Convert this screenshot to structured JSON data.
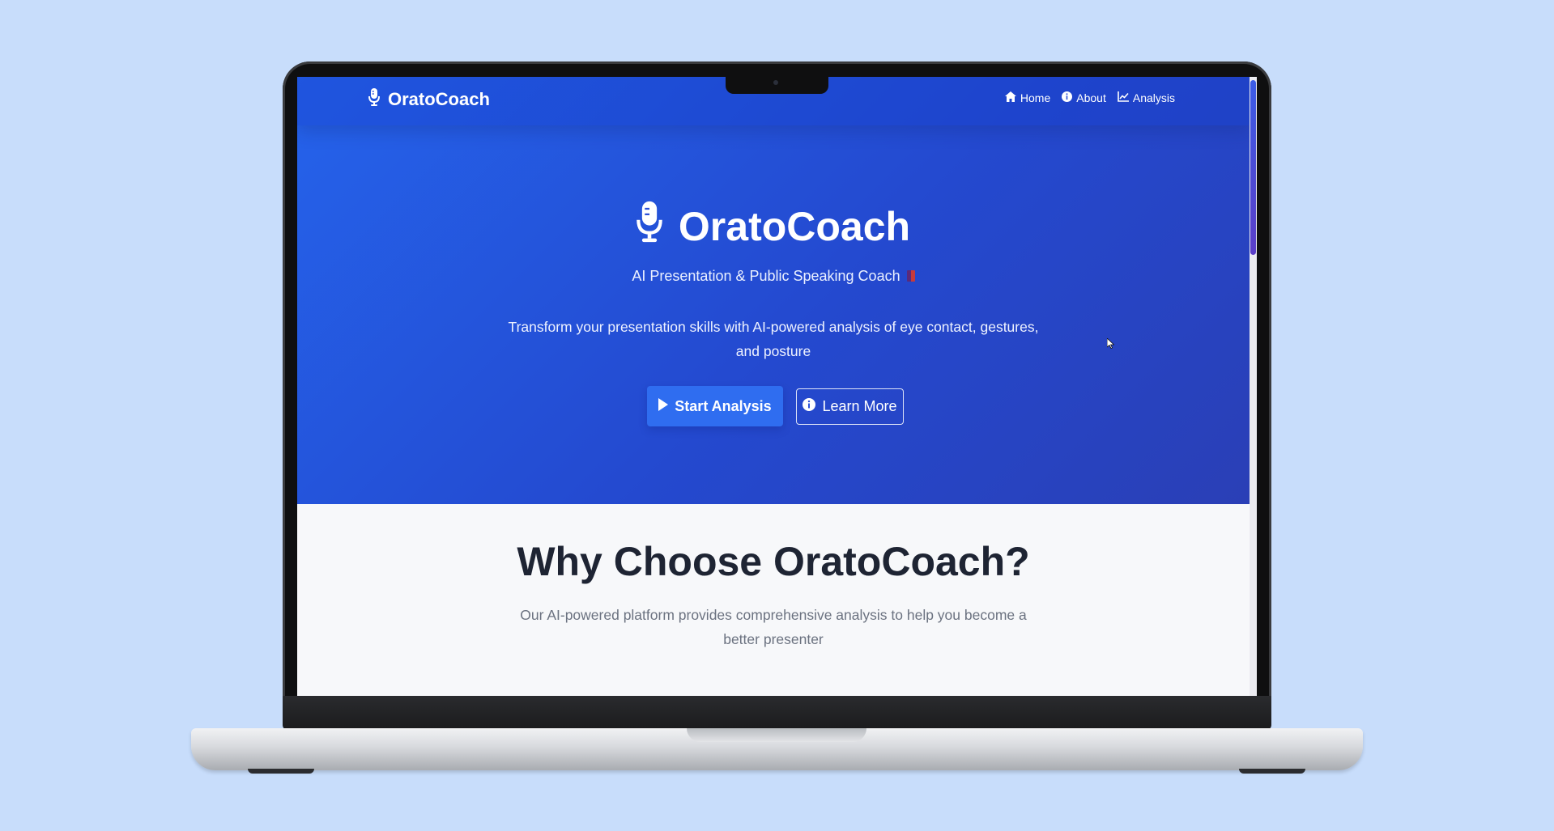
{
  "navbar": {
    "brand": "OratoCoach",
    "links": [
      {
        "label": "Home",
        "icon": "home-icon"
      },
      {
        "label": "About",
        "icon": "info-icon"
      },
      {
        "label": "Analysis",
        "icon": "chart-line-icon"
      }
    ]
  },
  "hero": {
    "title": "OratoCoach",
    "subtitle": "AI Presentation & Public Speaking Coach",
    "description": "Transform your presentation skills with AI-powered analysis of eye contact, gestures, and posture",
    "primary_button": "Start Analysis",
    "secondary_button": "Learn More"
  },
  "features": {
    "title": "Why Choose OratoCoach?",
    "subtitle": "Our AI-powered platform provides comprehensive analysis to help you become a better presenter"
  },
  "colors": {
    "page_background": "#c8ddfb",
    "hero_gradient_start": "#2563eb",
    "hero_gradient_end": "#2a3fb6",
    "primary_button": "#2f6df0",
    "section_background": "#f7f8fa",
    "section_title": "#1e2433"
  },
  "scrollbar": {
    "position": 0.0
  }
}
